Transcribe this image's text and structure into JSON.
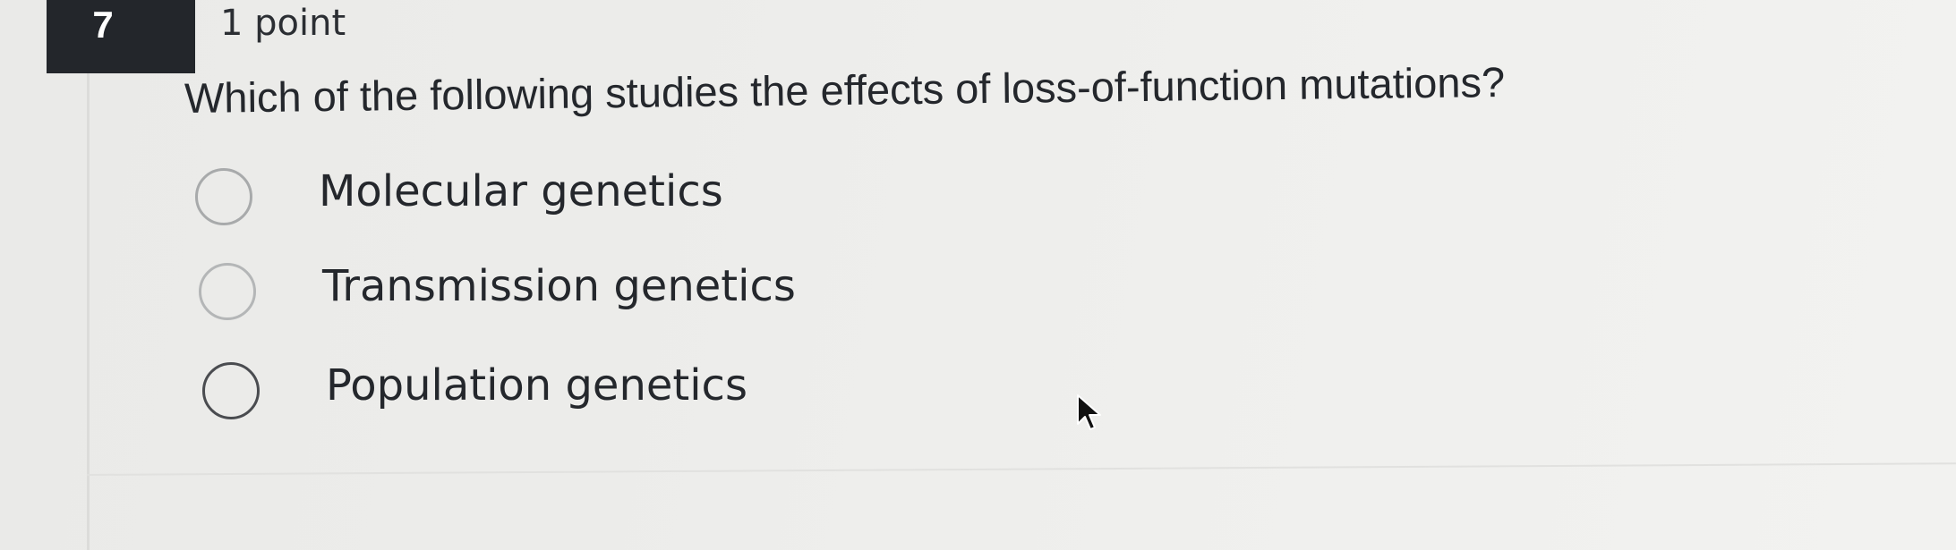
{
  "question": {
    "number": "7",
    "points_label": "1 point",
    "prompt": "Which of the following studies the effects of loss-of-function mutations?"
  },
  "options": [
    {
      "label": "Molecular genetics",
      "selected": false
    },
    {
      "label": "Transmission genetics",
      "selected": false
    },
    {
      "label": "Population genetics",
      "selected": false
    }
  ],
  "icons": {
    "cursor": "mouse-pointer-icon",
    "radio": "radio-button-icon"
  },
  "colors": {
    "badge_background": "#23262b",
    "badge_text": "#ffffff",
    "text": "#24272c",
    "radio_border": "#9a9c9e"
  }
}
